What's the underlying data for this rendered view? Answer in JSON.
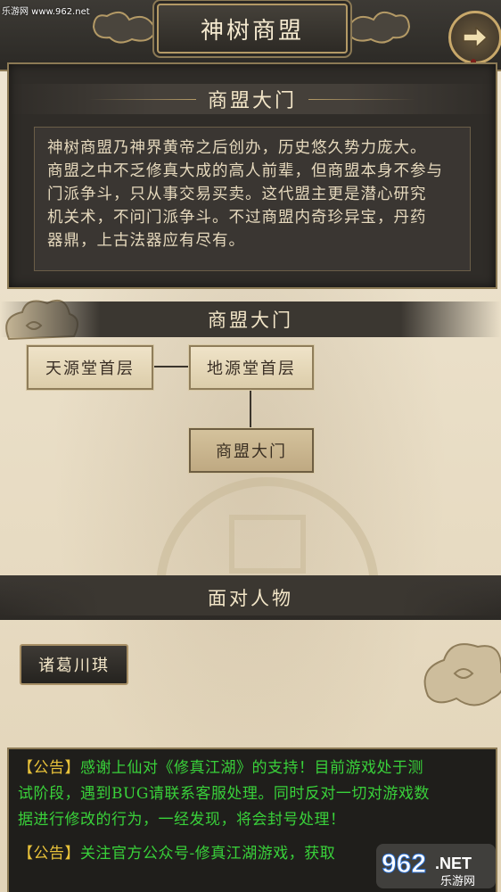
{
  "watermark": {
    "site": "乐游网 www.962.net",
    "logo_num": "962",
    "logo_net": ".NET",
    "logo_sub": "乐游网"
  },
  "header": {
    "title": "神树商盟",
    "back_icon": "arrow-right-icon"
  },
  "intro": {
    "heading": "商盟大门",
    "lines": [
      "神树商盟乃神界黄帝之后创办，历史悠久势力庞大。",
      "商盟之中不乏修真大成的高人前辈，但商盟本身不参与",
      "门派争斗，只从事交易买卖。这代盟主更是潜心研究",
      "机关术，不问门派争斗。不过商盟内奇珍异宝，丹药",
      "器鼎，上古法器应有尽有。"
    ]
  },
  "map": {
    "heading": "商盟大门",
    "nodes": {
      "tianyuan": "天源堂首层",
      "diyuan": "地源堂首层",
      "gate": "商盟大门"
    }
  },
  "people": {
    "heading": "面对人物",
    "items": [
      "诸葛川琪"
    ]
  },
  "notices": [
    {
      "tag": "【公告】",
      "text": "感谢上仙对《修真江湖》的支持！目前游戏处于测"
    },
    {
      "tag": "",
      "text": "试阶段，遇到BUG请联系客服处理。同时反对一切对游戏数"
    },
    {
      "tag": "",
      "text": "据进行修改的行为，一经发现，将会封号处理！"
    },
    {
      "tag": "【公告】",
      "text": "关注官方公众号-修真江湖游戏，获取"
    }
  ],
  "colors": {
    "notice_text": "#39d13a",
    "notice_tag": "#e8c23a",
    "panel_bg": "#2f2c28",
    "frame_gold": "#b49a66"
  }
}
